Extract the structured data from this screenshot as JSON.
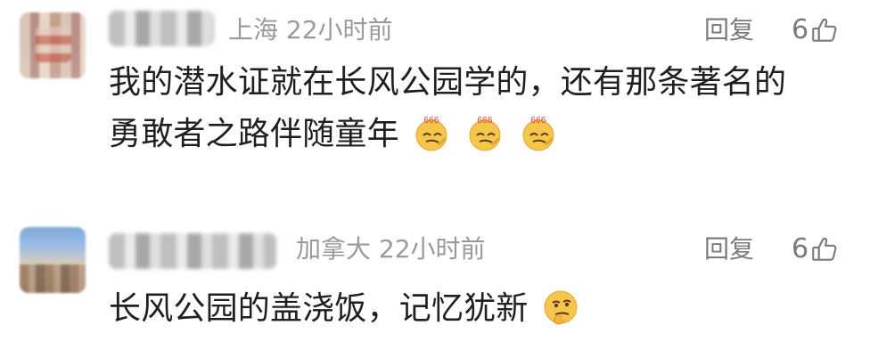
{
  "comments": [
    {
      "meta": "上海  22小时前",
      "reply_label": "回复",
      "like_count": "6",
      "content_line1": "我的潜水证就在长风公园学的，还有那条著名的",
      "content_line2": "勇敢者之路伴随童年",
      "emoji_text": "666"
    },
    {
      "meta": "加拿大  22小时前",
      "reply_label": "回复",
      "like_count": "6",
      "content": "长风公园的盖浇饭，记忆犹新"
    }
  ],
  "colors": {
    "primary_text": "#1f1f1f",
    "meta_text": "#9a9a9a",
    "action_text": "#7a7a7a",
    "emoji_yellow": "#f6c64b",
    "emoji_red": "#e53935"
  },
  "icons": {
    "like": "thumbs-up-icon",
    "emoji_666": "666-smirk-emoji-icon",
    "emoji_thinking": "thinking-face-emoji-icon"
  }
}
